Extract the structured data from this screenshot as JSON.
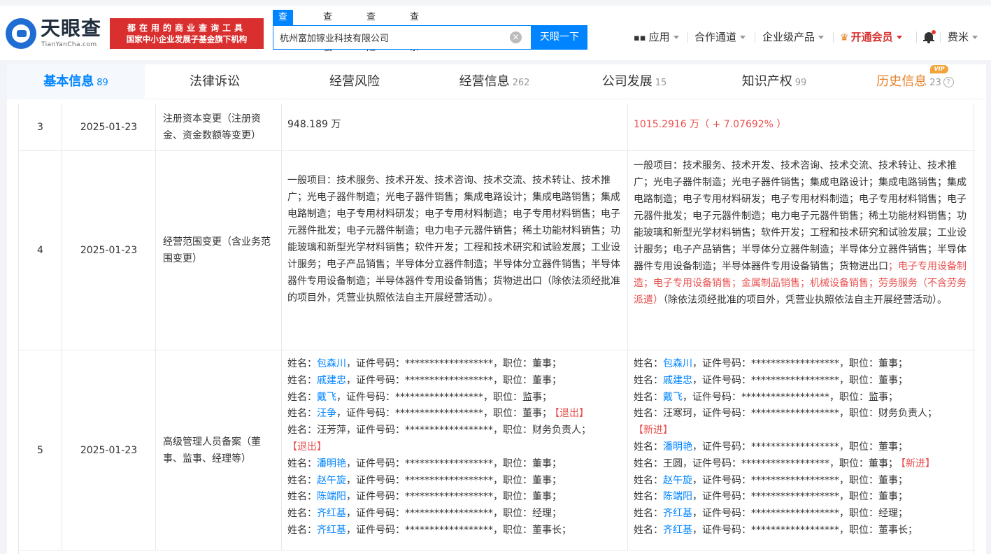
{
  "header": {
    "logo_cn": "天眼查",
    "logo_en": "TianYanCha.com",
    "slogan_line1": "都在用的商业查询工具",
    "slogan_line2": "国家中小企业发展子基金旗下机构",
    "search_tabs": [
      "查公司",
      "查老板",
      "查风险",
      "查关系"
    ],
    "search_value": "杭州富加镓业科技有限公司",
    "search_button": "天眼一下",
    "nav": {
      "apps": "应用",
      "channel": "合作通道",
      "enterprise": "企业级产品",
      "vip": "开通会员",
      "user": "费米"
    }
  },
  "tabs": [
    {
      "label": "基本信息",
      "count": "89"
    },
    {
      "label": "法律诉讼",
      "count": ""
    },
    {
      "label": "经营风险",
      "count": ""
    },
    {
      "label": "经营信息",
      "count": "262"
    },
    {
      "label": "公司发展",
      "count": "15"
    },
    {
      "label": "知识产权",
      "count": "99"
    },
    {
      "label": "历史信息",
      "count": "23",
      "badge": "VIP"
    }
  ],
  "rows": [
    {
      "no": "3",
      "date": "2025-01-23",
      "item": "注册资本变更（注册资金、资金数额等变更）",
      "before": "948.189 万",
      "after": "1015.2916 万（ + 7.07692% ）"
    },
    {
      "no": "4",
      "date": "2025-01-23",
      "item": "经营范围变更（含业务范围变更）",
      "before": "一般项目：技术服务、技术开发、技术咨询、技术交流、技术转让、技术推广；光电子器件制造；光电子器件销售；集成电路设计；集成电路销售；集成电路制造；电子专用材料研发；电子专用材料制造；电子专用材料销售；电子元器件批发；电子元器件制造；电力电子元器件销售；稀土功能材料销售；功能玻璃和新型光学材料销售；软件开发；工程和技术研究和试验发展；工业设计服务；电子产品销售；半导体分立器件制造；半导体分立器件销售；半导体器件专用设备制造；半导体器件专用设备销售；货物进出口（除依法须经批准的项目外，凭营业执照依法自主开展经营活动）。",
      "after_plain_1": "一般项目：技术服务、技术开发、技术咨询、技术交流、技术转让、技术推广；光电子器件制造；光电子器件销售；集成电路设计；集成电路销售；集成电路制造；电子专用材料研发；电子专用材料制造；电子专用材料销售；电子元器件批发；电子元器件制造；电力电子元器件销售；稀土功能材料销售；功能玻璃和新型光学材料销售；软件开发；工程和技术研究和试验发展；工业设计服务；电子产品销售；半导体分立器件制造；半导体分立器件销售；半导体器件专用设备制造；半导体器件专用设备销售；货物进出口",
      "after_new": "；电子专用设备制造；电子专用设备销售；金属制品销售；机械设备销售；劳务服务（不含劳务派遣）",
      "after_plain_2": "（除依法须经批准的项目外，凭营业执照依法自主开展经营活动）。"
    },
    {
      "no": "5",
      "date": "2025-01-23",
      "item": "高级管理人员备案（董事、监事、经理等）",
      "labels": {
        "name": "姓名：",
        "id": "，证件号码：",
        "pos": "，职位："
      },
      "mask": "******************",
      "before_people": [
        {
          "name": "包森川",
          "pos": "董事；",
          "linked": true
        },
        {
          "name": "戚建忠",
          "pos": "董事；",
          "linked": true
        },
        {
          "name": "戴飞",
          "pos": "监事；",
          "linked": true
        },
        {
          "name": "汪争",
          "pos": "董事；",
          "linked": true,
          "tag": "【退出】"
        },
        {
          "name": "汪芳萍",
          "pos": "财务负责人；",
          "linked": false,
          "tag": "【退出】",
          "wrap": true
        },
        {
          "name": "潘明艳",
          "pos": "董事；",
          "linked": true
        },
        {
          "name": "赵午旋",
          "pos": "董事；",
          "linked": true
        },
        {
          "name": "陈端阳",
          "pos": "董事；",
          "linked": true
        },
        {
          "name": "齐红基",
          "pos": "经理；",
          "linked": true
        },
        {
          "name": "齐红基",
          "pos": "董事长；",
          "linked": true
        }
      ],
      "after_people": [
        {
          "name": "包森川",
          "pos": "董事；",
          "linked": true
        },
        {
          "name": "戚建忠",
          "pos": "董事；",
          "linked": true
        },
        {
          "name": "戴飞",
          "pos": "监事；",
          "linked": true
        },
        {
          "name": "汪寒珂",
          "pos": "财务负责人；",
          "linked": false,
          "tag": "【新进】",
          "wrap": true
        },
        {
          "name": "潘明艳",
          "pos": "董事；",
          "linked": true
        },
        {
          "name": "王圆",
          "pos": "董事；",
          "linked": false,
          "tag": "【新进】"
        },
        {
          "name": "赵午旋",
          "pos": "董事；",
          "linked": true
        },
        {
          "name": "陈端阳",
          "pos": "董事；",
          "linked": true
        },
        {
          "name": "齐红基",
          "pos": "经理；",
          "linked": true
        },
        {
          "name": "齐红基",
          "pos": "董事长；",
          "linked": true
        }
      ]
    }
  ],
  "colors": {
    "brand_blue": "#0084ff",
    "highlight_red": "#e9514f",
    "vip_orange": "#e7832b"
  }
}
